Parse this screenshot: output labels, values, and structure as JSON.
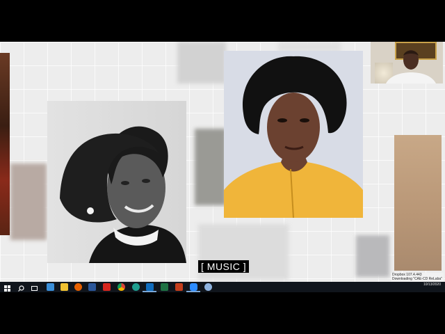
{
  "caption": {
    "text": "[ MUSIC ]"
  },
  "notification": {
    "title": "Dropbox 107.4.443",
    "status": "Downloading \"CAE-CD ReLaba\""
  },
  "clock": {
    "time": "",
    "date": "10/13/2020"
  },
  "taskbar": {
    "icons": [
      {
        "name": "start-icon",
        "color": "#ffffff"
      },
      {
        "name": "search-icon",
        "color": "#ffffff"
      },
      {
        "name": "task-view-icon",
        "color": "#ffffff"
      },
      {
        "name": "edge-icon",
        "color": "#3a8fd9"
      },
      {
        "name": "file-explorer-icon",
        "color": "#f1c232"
      },
      {
        "name": "firefox-icon",
        "color": "#e66000"
      },
      {
        "name": "word-icon",
        "color": "#2b579a"
      },
      {
        "name": "acrobat-icon",
        "color": "#d7261e"
      },
      {
        "name": "chrome-icon",
        "color": "#4caf50"
      },
      {
        "name": "app-icon",
        "color": "#1e9e8f"
      },
      {
        "name": "outlook-icon",
        "color": "#0f6cbd"
      },
      {
        "name": "excel-icon",
        "color": "#1f7244"
      },
      {
        "name": "powerpoint-icon",
        "color": "#c43e1c"
      },
      {
        "name": "zoom-icon",
        "color": "#2d8cff"
      },
      {
        "name": "paint-icon",
        "color": "#8fb3e0"
      }
    ]
  }
}
